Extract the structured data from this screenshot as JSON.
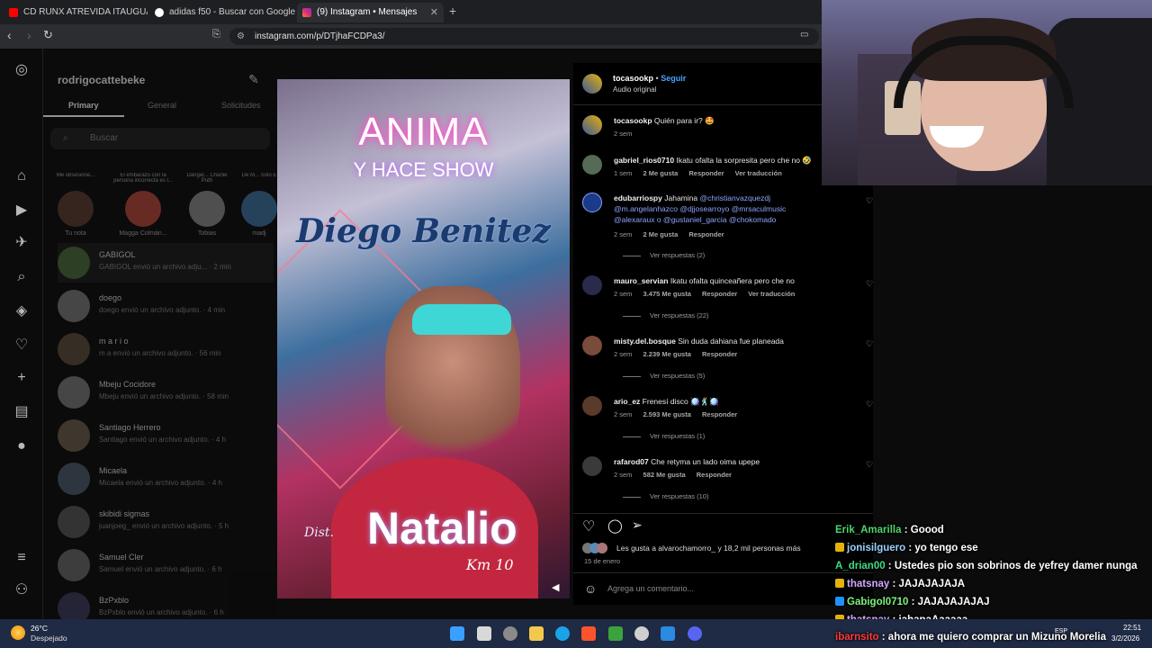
{
  "tabs": [
    {
      "label": "CD RUNX ATREVIDA ITAUGUA PY",
      "active": false
    },
    {
      "label": "adidas f50 - Buscar con Google",
      "active": false
    },
    {
      "label": "(9) Instagram • Mensajes",
      "active": true
    }
  ],
  "address": {
    "url": "instagram.com/p/DTjhaFCDPa3/"
  },
  "dm": {
    "username": "rodrigocattebeke",
    "tabs": [
      "Primary",
      "General",
      "Solicitudes"
    ],
    "search_placeholder": "Buscar",
    "notes": [
      {
        "label": "Tu nota",
        "bubble": "Me obsesione..."
      },
      {
        "label": "Magga Colmán...",
        "bubble": "El embarazo con la persona incorrecta es l..."
      },
      {
        "label": "Tobias",
        "bubble": "Danger... Charlie Puth"
      },
      {
        "label": "madj",
        "bubble": "De M... Solo E"
      }
    ],
    "conversations": [
      {
        "name": "GABIGOL",
        "preview": "GABIGOL envió un archivo adju... · 2 min"
      },
      {
        "name": "doego",
        "preview": "doego envió un archivo adjunto. · 4 min"
      },
      {
        "name": "m a r i o",
        "preview": "m a envió un archivo adjunto. · 56 min"
      },
      {
        "name": "Mbeju Cocidore",
        "preview": "Mbeju envió un archivo adjunto. · 58 min"
      },
      {
        "name": "Santiago Herrero",
        "preview": "Santiago envió un archivo adjunto. · 4 h"
      },
      {
        "name": "Micaela",
        "preview": "Micaela envió un archivo adjunto. · 4 h"
      },
      {
        "name": "skibidi sigmas",
        "preview": "juanjoeg_ envió un archivo adjunto. · 5 h"
      },
      {
        "name": "Samuel Cler",
        "preview": "Samuel envió un archivo adjunto. · 6 h"
      },
      {
        "name": "BzPxblo",
        "preview": "BzPxblo envió un archivo adjunto. · 6 h"
      }
    ]
  },
  "post": {
    "image_text": {
      "line1": "ANIMA",
      "line2": "Y HACE SHOW",
      "line3": "Diego Benitez",
      "line4": "Natalio",
      "line5": "Km 10",
      "prefix": "Dist."
    },
    "author": "tocasookp",
    "follow_label": "Seguir",
    "sub": "Audio original",
    "comments": [
      {
        "user": "tocasookp",
        "text": "Quién para ir? 🤩",
        "meta": [
          "2 sem"
        ],
        "replies": ""
      },
      {
        "user": "gabriel_rios0710",
        "text": "Ikatu ofalta la sorpresita pero che no 🤣",
        "meta": [
          "1 sem",
          "2 Me gusta",
          "Responder",
          "Ver traducción"
        ],
        "replies": ""
      },
      {
        "user": "edubarriospy",
        "text": "Jahamina",
        "mentions": "@christianvazquezdj @m.angelanhazco @djjosearroyo @mrsaculmusic @alexaraux o @gustaniel_garcia @chokomado",
        "meta": [
          "2 sem",
          "2 Me gusta",
          "Responder"
        ],
        "replies": "Ver respuestas (2)"
      },
      {
        "user": "mauro_servian",
        "text": "Ikatu ofalta quinceañera pero che no",
        "meta": [
          "2 sem",
          "3.475 Me gusta",
          "Responder",
          "Ver traducción"
        ],
        "replies": "Ver respuestas (22)"
      },
      {
        "user": "misty.del.bosque",
        "text": "Sin duda dahiana fue planeada",
        "meta": [
          "2 sem",
          "2.239 Me gusta",
          "Responder"
        ],
        "replies": "Ver respuestas (5)"
      },
      {
        "user": "ario_ez",
        "text": "Frenesí disco 🪩🕺🪩",
        "meta": [
          "2 sem",
          "2.593 Me gusta",
          "Responder"
        ],
        "replies": "Ver respuestas (1)"
      },
      {
        "user": "rafarod07",
        "text": "Che retyma un lado oima upepe",
        "meta": [
          "2 sem",
          "582 Me gusta",
          "Responder"
        ],
        "replies": "Ver respuestas (10)"
      }
    ],
    "likes_text": "Les gusta a alvarochamorro_ y 18,2 mil personas más",
    "date": "15 de enero",
    "comment_placeholder": "Agrega un comentario..."
  },
  "chat": [
    {
      "user": "Erik_Amarilla",
      "msg": "Goood",
      "color": "#4fd36b",
      "badge": ""
    },
    {
      "user": "jonisilguero",
      "msg": "yo tengo ese",
      "color": "#9ad0ff",
      "badge": "#e7b10a"
    },
    {
      "user": "A_drian00",
      "msg": "Ustedes pio son sobrinos de yefrey damer nunga",
      "color": "#3ddc84",
      "badge": ""
    },
    {
      "user": "thatsnay",
      "msg": "JAJAJAJAJA",
      "color": "#d2a8ff",
      "badge": "#e7b10a"
    },
    {
      "user": "Gabigol0710",
      "msg": "JAJAJAJAJAJ",
      "color": "#7cf27c",
      "badge": "#1e90ff"
    },
    {
      "user": "thatsnay",
      "msg": "jahapaAaaaaa",
      "color": "#d2a8ff",
      "badge": "#e7b10a"
    },
    {
      "user": "ibarnsito",
      "msg": "ahora me quiero comprar un Mizuno Morelia",
      "color": "#ff3b3b",
      "badge": ""
    }
  ],
  "taskbar": {
    "weather_temp": "26°C",
    "weather_desc": "Despejado",
    "lang": "ESP",
    "time": "22:51",
    "date": "3/2/2026"
  }
}
